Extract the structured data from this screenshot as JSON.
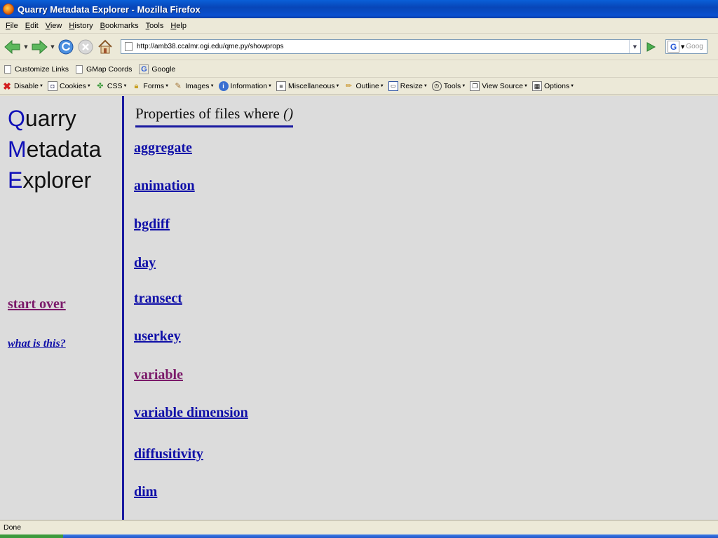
{
  "window": {
    "title": "Quarry Metadata Explorer - Mozilla Firefox"
  },
  "menubar": {
    "items": [
      "File",
      "Edit",
      "View",
      "History",
      "Bookmarks",
      "Tools",
      "Help"
    ]
  },
  "navbar": {
    "url": "http://amb38.ccalmr.ogi.edu/qme.py/showprops",
    "search_placeholder": "Goog"
  },
  "bookmarks": {
    "items": [
      "Customize Links",
      "GMap Coords",
      "Google"
    ]
  },
  "devbar": {
    "items": [
      "Disable",
      "Cookies",
      "CSS",
      "Forms",
      "Images",
      "Information",
      "Miscellaneous",
      "Outline",
      "Resize",
      "Tools",
      "View Source",
      "Options"
    ]
  },
  "sidebar": {
    "logo": [
      {
        "cap": "Q",
        "rest": "uarry"
      },
      {
        "cap": "M",
        "rest": "etadata"
      },
      {
        "cap": "E",
        "rest": "xplorer"
      }
    ],
    "start_over": "start over",
    "what_is_this": "what is this?"
  },
  "main": {
    "heading": "Properties of files where ",
    "heading_paren": "()",
    "properties": [
      {
        "label": "aggregate",
        "visited": false
      },
      {
        "label": "animation",
        "visited": false
      },
      {
        "label": "bgdiff",
        "visited": false
      },
      {
        "label": "day",
        "visited": false
      },
      {
        "label": "transect",
        "visited": false
      },
      {
        "label": "userkey",
        "visited": false
      },
      {
        "label": "variable",
        "visited": true
      },
      {
        "label": "variable dimension",
        "visited": false
      },
      {
        "label": "diffusitivity",
        "visited": false
      },
      {
        "label": "dim",
        "visited": false
      }
    ]
  },
  "status": {
    "text": "Done"
  },
  "colors": {
    "link": "#1010a8",
    "visited": "#7b1a6a",
    "accent_rule": "#1a1aa0",
    "page_bg": "#dcdcdc"
  }
}
